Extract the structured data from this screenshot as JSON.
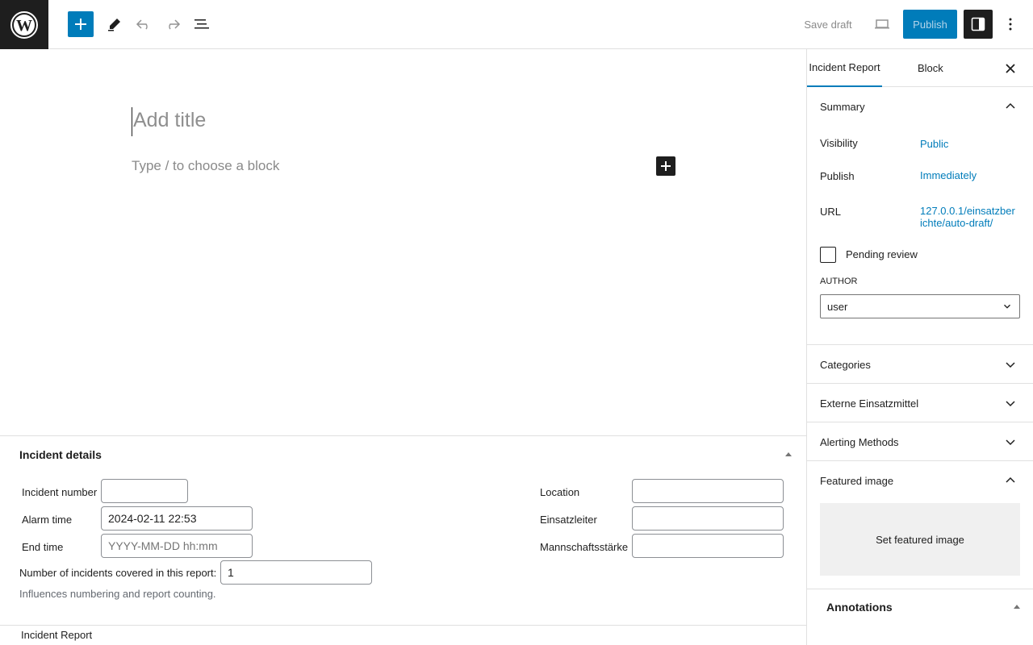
{
  "toolbar": {
    "save_draft": "Save draft",
    "publish": "Publish",
    "icons": [
      "wordpress-logo",
      "plus-icon",
      "pencil-icon",
      "undo-icon",
      "redo-icon",
      "list-view-icon",
      "laptop-icon",
      "sidebar-icon",
      "more-vertical-icon"
    ],
    "accent_color": "#007cba"
  },
  "editor": {
    "title_placeholder": "Add title",
    "block_placeholder": "Type / to choose a block"
  },
  "sidebar": {
    "tabs": [
      "Incident Report",
      "Block"
    ],
    "summary": {
      "title": "Summary",
      "visibility_label": "Visibility",
      "visibility_value": "Public",
      "publish_label": "Publish",
      "publish_value": "Immediately",
      "url_label": "URL",
      "url_value": "127.0.0.1/einsatzberichte/auto-draft/",
      "pending_review": "Pending review",
      "author_label": "AUTHOR",
      "author_value": "user"
    },
    "panels": [
      "Categories",
      "Externe Einsatzmittel",
      "Alerting Methods"
    ],
    "featured_image": {
      "title": "Featured image",
      "button": "Set featured image"
    },
    "annotations": "Annotations"
  },
  "metabox": {
    "title": "Incident details",
    "incident_number_label": "Incident number",
    "incident_number_value": "",
    "alarm_time_label": "Alarm time",
    "alarm_time_value": "2024-02-11 22:53",
    "end_time_label": "End time",
    "end_time_placeholder": "YYYY-MM-DD hh:mm",
    "location_label": "Location",
    "einsatzleiter_label": "Einsatzleiter",
    "mannschaft_label": "Mannschaftsstärke",
    "incidents_count_label": "Number of incidents covered in this report:",
    "incidents_count_value": "1",
    "help_text": "Influences numbering and report counting."
  },
  "footer": {
    "breadcrumb": "Incident Report"
  }
}
